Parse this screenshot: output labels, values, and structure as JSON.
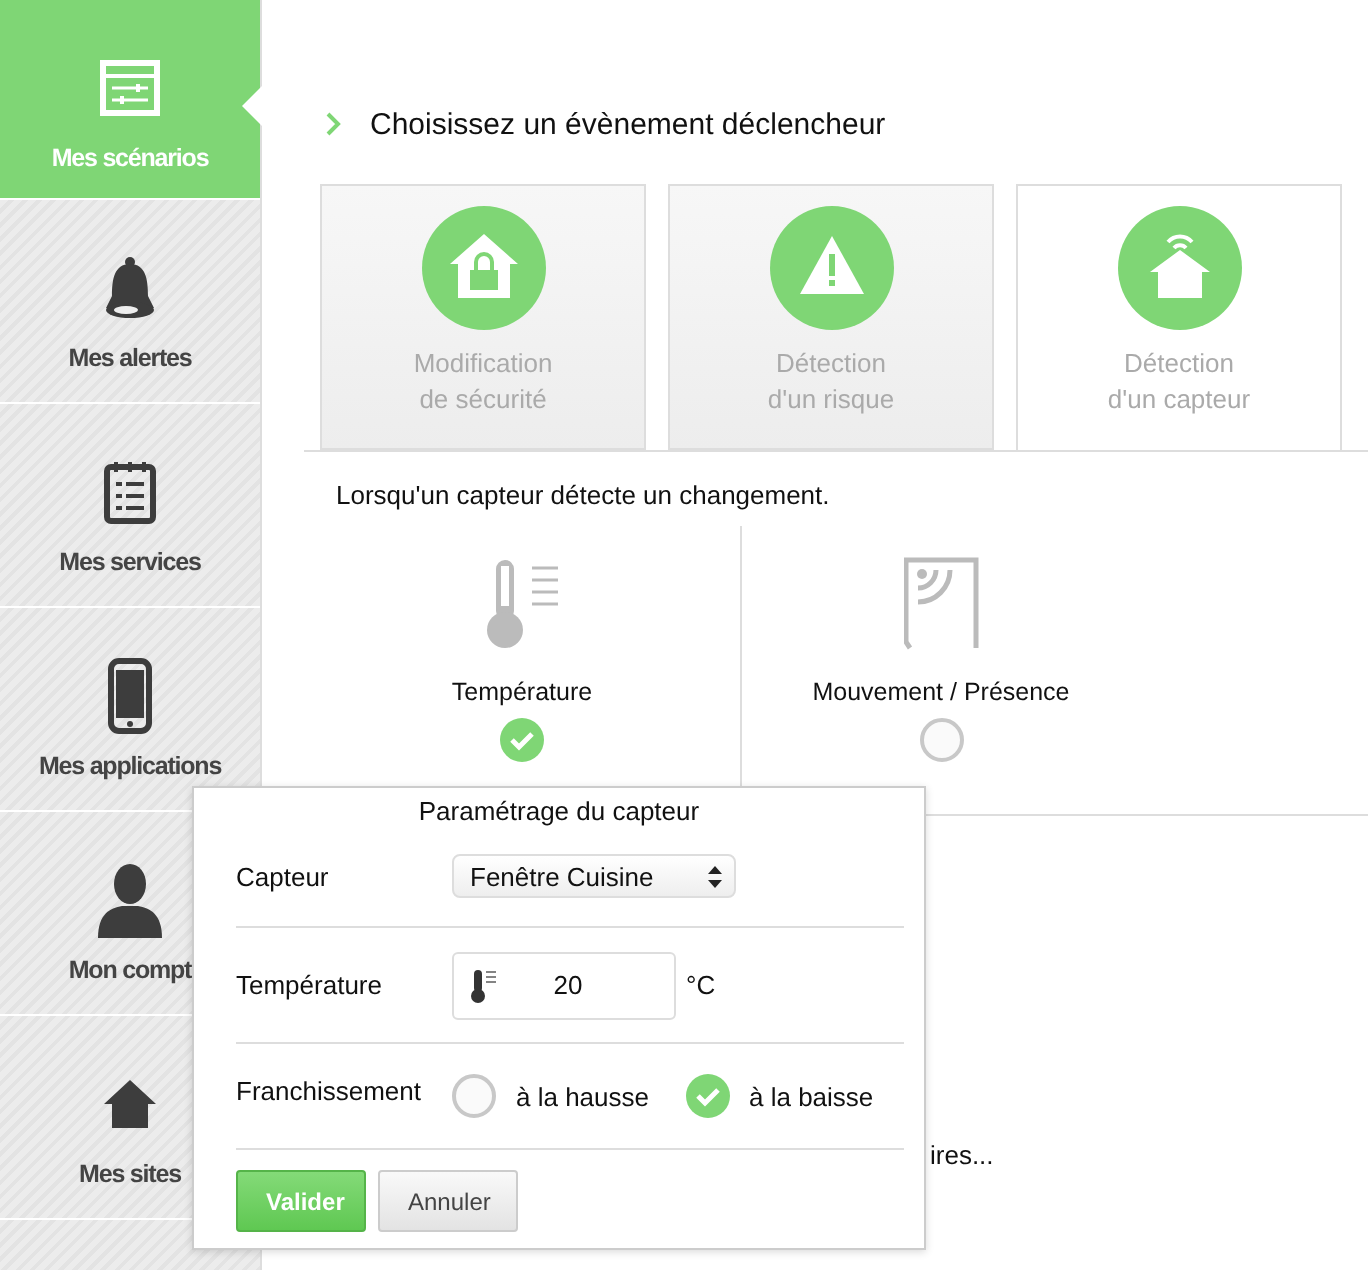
{
  "sidebar": {
    "items": [
      {
        "label": "Mes scénarios",
        "selected": true
      },
      {
        "label": "Mes alertes",
        "selected": false
      },
      {
        "label": "Mes services",
        "selected": false
      },
      {
        "label": "Mes applications",
        "selected": false
      },
      {
        "label": "Mon compt",
        "selected": false
      },
      {
        "label": "Mes sites",
        "selected": false
      },
      {
        "selected": false
      }
    ]
  },
  "heading": "Choisissez un évènement déclencheur",
  "tabs": [
    {
      "label": "Modification\nde sécurité",
      "selected": false
    },
    {
      "label": "Détection\nd'un risque",
      "selected": false
    },
    {
      "label": "Détection\nd'un capteur",
      "selected": true
    }
  ],
  "panel": {
    "description": "Lorsqu'un capteur détecte un changement.",
    "options": [
      {
        "label": "Température",
        "selected": true
      },
      {
        "label": "Mouvement / Présence",
        "selected": false
      }
    ]
  },
  "hidden_text": "ires...",
  "dialog": {
    "title": "Paramétrage du capteur",
    "sensor": {
      "label": "Capteur",
      "value": "Fenêtre Cuisine"
    },
    "temperature": {
      "label": "Température",
      "value": "20",
      "unit": "°C"
    },
    "crossing": {
      "label": "Franchissement",
      "options": [
        {
          "label": "à la hausse",
          "selected": false
        },
        {
          "label": "à la baisse",
          "selected": true
        }
      ]
    },
    "buttons": [
      {
        "label": "Valider",
        "kind": "primary"
      },
      {
        "label": "Annuler",
        "kind": "secondary"
      }
    ]
  }
}
